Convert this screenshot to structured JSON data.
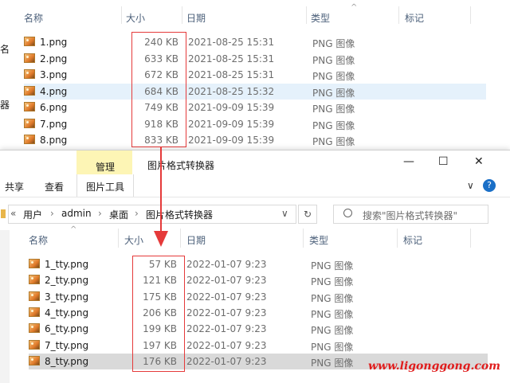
{
  "top_window": {
    "headers": {
      "name": "名称",
      "size": "大小",
      "date": "日期",
      "type": "类型",
      "tag": "标记"
    },
    "left_edge_chars": [
      "名",
      "器"
    ],
    "files": [
      {
        "name": "1.png",
        "size": "240 KB",
        "date": "2021-08-25 15:31",
        "type": "PNG 图像"
      },
      {
        "name": "2.png",
        "size": "633 KB",
        "date": "2021-08-25 15:31",
        "type": "PNG 图像"
      },
      {
        "name": "3.png",
        "size": "672 KB",
        "date": "2021-08-25 15:31",
        "type": "PNG 图像"
      },
      {
        "name": "4.png",
        "size": "684 KB",
        "date": "2021-08-25 15:32",
        "type": "PNG 图像"
      },
      {
        "name": "6.png",
        "size": "749 KB",
        "date": "2021-09-09 15:39",
        "type": "PNG 图像"
      },
      {
        "name": "7.png",
        "size": "918 KB",
        "date": "2021-09-09 15:39",
        "type": "PNG 图像"
      },
      {
        "name": "8.png",
        "size": "833 KB",
        "date": "2021-09-09 15:39",
        "type": "PNG 图像"
      }
    ],
    "selected_row": 3
  },
  "bottom_window": {
    "title": "图片格式转换器",
    "context_tab": "管理",
    "context_tab_tools": "图片工具",
    "ribbon_tabs": [
      "共享",
      "查看"
    ],
    "controls": {
      "minimize": "—",
      "maximize": "☐",
      "close": "✕",
      "collapse": "∨",
      "help": "?"
    },
    "breadcrumb": [
      "用户",
      "admin",
      "桌面",
      "图片格式转换器"
    ],
    "breadcrumb_sep": "›",
    "refresh_glyph": "↻",
    "dropdown_glyph": "∨",
    "search_placeholder": "搜索\"图片格式转换器\"",
    "headers": {
      "name": "名称",
      "size": "大小",
      "date": "日期",
      "type": "类型",
      "tag": "标记"
    },
    "files": [
      {
        "name": "1_tty.png",
        "size": "57 KB",
        "date": "2022-01-07 9:23",
        "type": "PNG 图像"
      },
      {
        "name": "2_tty.png",
        "size": "121 KB",
        "date": "2022-01-07 9:23",
        "type": "PNG 图像"
      },
      {
        "name": "3_tty.png",
        "size": "175 KB",
        "date": "2022-01-07 9:23",
        "type": "PNG 图像"
      },
      {
        "name": "4_tty.png",
        "size": "206 KB",
        "date": "2022-01-07 9:23",
        "type": "PNG 图像"
      },
      {
        "name": "6_tty.png",
        "size": "199 KB",
        "date": "2022-01-07 9:23",
        "type": "PNG 图像"
      },
      {
        "name": "7_tty.png",
        "size": "197 KB",
        "date": "2022-01-07 9:23",
        "type": "PNG 图像"
      },
      {
        "name": "8_tty.png",
        "size": "176 KB",
        "date": "2022-01-07 9:23",
        "type": "PNG 图像"
      }
    ],
    "selected_row": 6
  },
  "watermark": "www.ligonggong.com",
  "colors": {
    "highlight": "#e53a3a",
    "selected_top": "#e5f1fb",
    "selected_bottom": "#d9d9d9",
    "context_tab": "#fdf5b5"
  }
}
